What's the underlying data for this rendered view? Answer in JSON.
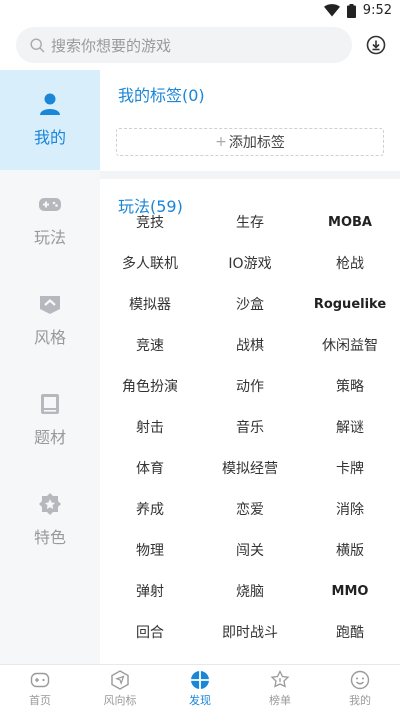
{
  "status": {
    "time": "9:52",
    "wifi_icon": "wifi-icon",
    "battery_icon": "battery-icon"
  },
  "search": {
    "placeholder": "搜索你想要的游戏",
    "icon": "search-icon",
    "download_icon": "download-icon"
  },
  "sidebar": {
    "items": [
      {
        "label": "我的",
        "icon": "user-icon",
        "active": true
      },
      {
        "label": "玩法",
        "icon": "gamepad-icon",
        "active": false
      },
      {
        "label": "风格",
        "icon": "style-icon",
        "active": false
      },
      {
        "label": "题材",
        "icon": "book-icon",
        "active": false
      },
      {
        "label": "特色",
        "icon": "badge-icon",
        "active": false
      }
    ]
  },
  "my_tags": {
    "title": "我的标签(0)",
    "add_label": "添加标签",
    "add_prefix": "+"
  },
  "gameplay": {
    "title": "玩法(59)",
    "tags": [
      "竞技",
      "生存",
      "MOBA",
      "多人联机",
      "IO游戏",
      "枪战",
      "模拟器",
      "沙盒",
      "Roguelike",
      "竞速",
      "战棋",
      "休闲益智",
      "角色扮演",
      "动作",
      "策略",
      "射击",
      "音乐",
      "解谜",
      "体育",
      "模拟经营",
      "卡牌",
      "养成",
      "恋爱",
      "消除",
      "物理",
      "闯关",
      "横版",
      "弹射",
      "烧脑",
      "MMO",
      "回合",
      "即时战斗",
      "跑酷"
    ]
  },
  "tabbar": {
    "tabs": [
      {
        "label": "首页",
        "icon": "home-icon",
        "active": false
      },
      {
        "label": "风向标",
        "icon": "compass-icon",
        "active": false
      },
      {
        "label": "发现",
        "icon": "discover-icon",
        "active": true
      },
      {
        "label": "榜单",
        "icon": "ranking-icon",
        "active": false
      },
      {
        "label": "我的",
        "icon": "profile-icon",
        "active": false
      }
    ]
  },
  "colors": {
    "accent": "#1a86d8",
    "sidebar_bg": "#f6f7f9",
    "active_bg": "#d9eefb"
  }
}
